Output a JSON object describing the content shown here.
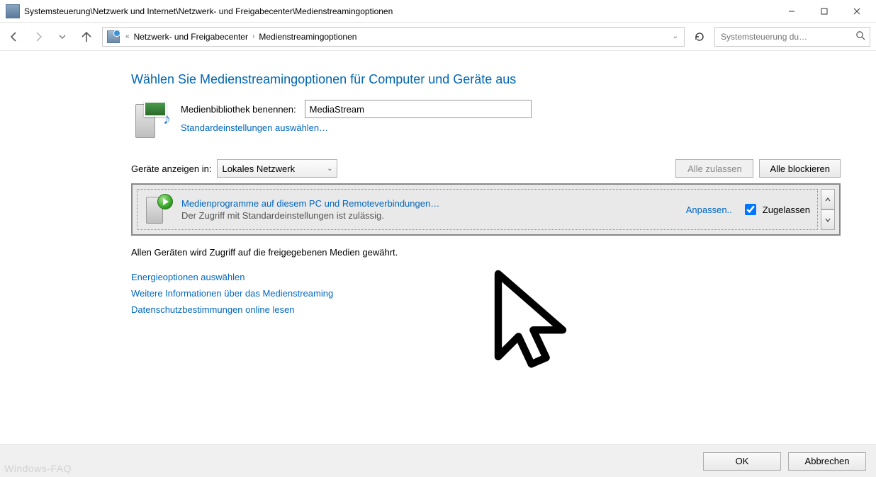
{
  "window": {
    "title": "Systemsteuerung\\Netzwerk und Internet\\Netzwerk- und Freigabecenter\\Medienstreamingoptionen"
  },
  "breadcrumb": {
    "prefix": "«",
    "item1": "Netzwerk- und Freigabecenter",
    "item2": "Medienstreamingoptionen"
  },
  "search": {
    "placeholder": "Systemsteuerung du…"
  },
  "page": {
    "title": "Wählen Sie Medienstreamingoptionen für Computer und Geräte aus"
  },
  "library": {
    "label": "Medienbibliothek benennen:",
    "value": "MediaStream",
    "defaults_link": "Standardeinstellungen auswählen…"
  },
  "devices": {
    "show_label": "Geräte anzeigen in:",
    "scope": "Lokales Netzwerk",
    "allow_all": "Alle zulassen",
    "block_all": "Alle blockieren"
  },
  "device_item": {
    "title": "Medienprogramme auf diesem PC und Remoteverbindungen…",
    "subtitle": "Der Zugriff mit Standardeinstellungen ist zulässig.",
    "customize": "Anpassen..",
    "allowed_label": "Zugelassen",
    "allowed_checked": true
  },
  "info": {
    "text": "Allen Geräten wird Zugriff auf die freigegebenen Medien gewährt."
  },
  "links": {
    "power": "Energieoptionen auswählen",
    "more": "Weitere Informationen über das Medienstreaming",
    "privacy": "Datenschutzbestimmungen online lesen"
  },
  "footer": {
    "ok": "OK",
    "cancel": "Abbrechen"
  },
  "watermark": "Windows-FAQ"
}
